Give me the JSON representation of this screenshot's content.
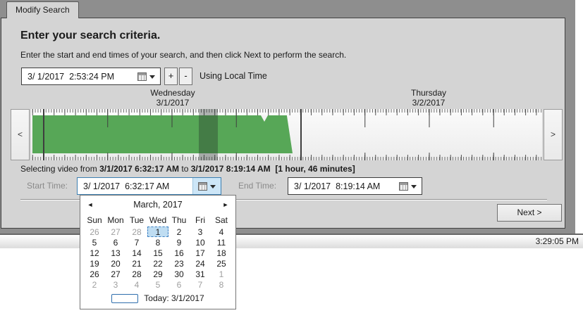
{
  "tab": {
    "label": "Modify Search"
  },
  "header": {
    "title": "Enter your search criteria.",
    "subtitle": "Enter the start and end times of your search, and then click Next to perform the search."
  },
  "current_time": {
    "value": "3/ 1/2017  2:53:24 PM",
    "plus_label": "+",
    "minus_label": "-",
    "note": "Using Local Time"
  },
  "timeline": {
    "days": [
      {
        "name": "Wednesday",
        "date": "3/1/2017"
      },
      {
        "name": "Thursday",
        "date": "3/2/2017"
      }
    ],
    "prev_label": "<",
    "next_label": ">"
  },
  "selection_line": {
    "prefix": "Selecting video from ",
    "start": "3/1/2017 6:32:17 AM",
    "joiner": " to ",
    "end": "3/1/2017 8:19:14 AM",
    "spacer": "  ",
    "duration": "[1 hour, 46 minutes]"
  },
  "start_time": {
    "label": "Start Time:",
    "value": "3/ 1/2017  6:32:17 AM"
  },
  "end_time": {
    "label": "End Time:",
    "value": "3/ 1/2017  8:19:14 AM"
  },
  "next_button": {
    "label": "Next >"
  },
  "status_bar": {
    "time": "3:29:05 PM"
  },
  "calendar": {
    "month_label": "March, 2017",
    "prev_icon": "◄",
    "next_icon": "►",
    "day_headers": [
      "Sun",
      "Mon",
      "Tue",
      "Wed",
      "Thu",
      "Fri",
      "Sat"
    ],
    "weeks": [
      [
        {
          "d": "26",
          "muted": true
        },
        {
          "d": "27",
          "muted": true
        },
        {
          "d": "28",
          "muted": true
        },
        {
          "d": "1",
          "selected": true
        },
        {
          "d": "2"
        },
        {
          "d": "3"
        },
        {
          "d": "4"
        }
      ],
      [
        {
          "d": "5"
        },
        {
          "d": "6"
        },
        {
          "d": "7"
        },
        {
          "d": "8"
        },
        {
          "d": "9"
        },
        {
          "d": "10"
        },
        {
          "d": "11"
        }
      ],
      [
        {
          "d": "12"
        },
        {
          "d": "13"
        },
        {
          "d": "14"
        },
        {
          "d": "15"
        },
        {
          "d": "16"
        },
        {
          "d": "17"
        },
        {
          "d": "18"
        }
      ],
      [
        {
          "d": "19"
        },
        {
          "d": "20"
        },
        {
          "d": "21"
        },
        {
          "d": "22"
        },
        {
          "d": "23"
        },
        {
          "d": "24"
        },
        {
          "d": "25"
        }
      ],
      [
        {
          "d": "26"
        },
        {
          "d": "27"
        },
        {
          "d": "28"
        },
        {
          "d": "29"
        },
        {
          "d": "30"
        },
        {
          "d": "31"
        },
        {
          "d": "1",
          "muted": true
        }
      ],
      [
        {
          "d": "2",
          "muted": true
        },
        {
          "d": "3",
          "muted": true
        },
        {
          "d": "4",
          "muted": true
        },
        {
          "d": "5",
          "muted": true
        },
        {
          "d": "6",
          "muted": true
        },
        {
          "d": "7",
          "muted": true
        },
        {
          "d": "8",
          "muted": true
        }
      ]
    ],
    "today_label": "Today: 3/1/2017"
  },
  "colors": {
    "video_green": "#57a757",
    "selection_overlay": "rgba(35,45,40,0.35)",
    "calendar_selected_bg": "#bfddf2",
    "calendar_selected_border": "#3f82c4",
    "today_box_border": "#2f6fad",
    "frame_gray": "#8e8e8e",
    "panel_gray": "#d4d4d4"
  }
}
